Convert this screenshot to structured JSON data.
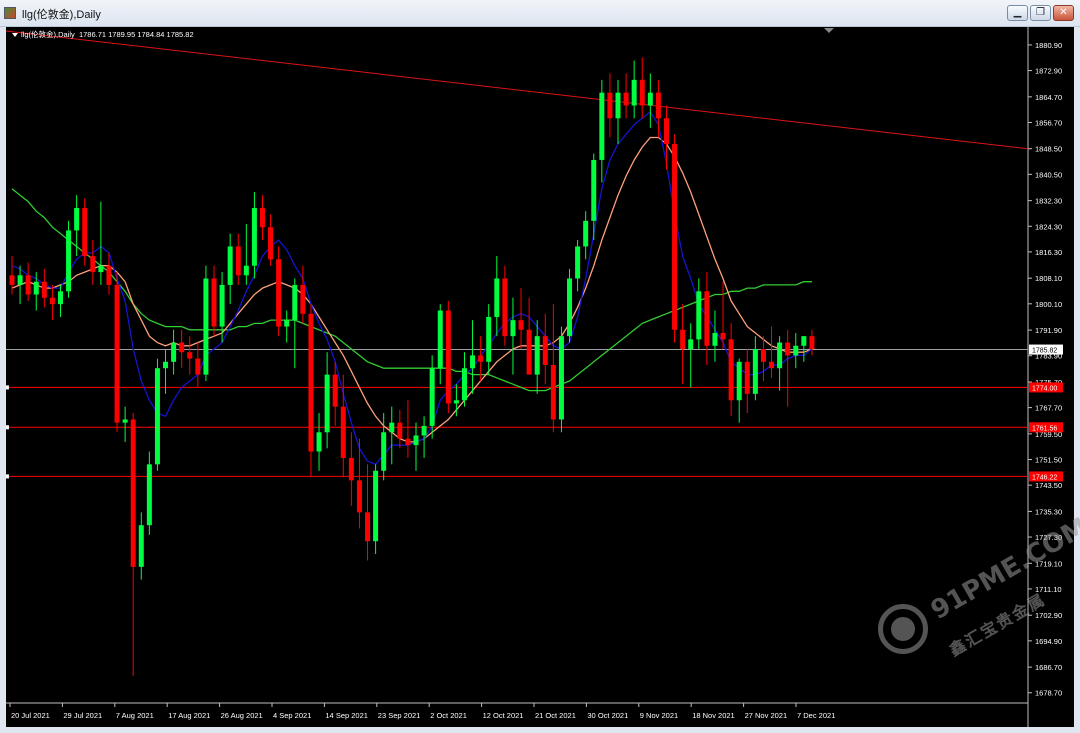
{
  "window": {
    "title": "llg(伦敦金),Daily",
    "buttons": [
      "minimize",
      "restore",
      "close"
    ]
  },
  "chart_header": {
    "symbol": "llg(伦敦金),Daily",
    "ohlc": "1786.71 1789.95 1784.84 1785.82"
  },
  "watermark": {
    "line1": "91PME.COM",
    "line2": "鑫汇宝贵金属"
  },
  "colors": {
    "background": "#000000",
    "bull": "#00ff40",
    "bear": "#ff0000",
    "ma_fast": "#1414d2",
    "ma_mid": "#ffa07a",
    "ma_slow": "#32cd32",
    "trendline": "#dc1414",
    "hline": "#ff0000",
    "last_price_line": "#9aa0a6"
  },
  "chart_data": {
    "type": "candlestick",
    "symbol": "llg(伦敦金)",
    "timeframe": "Daily",
    "ylim": [
      1675.5,
      1886.5
    ],
    "y_ticks": [
      "1880.90",
      "1872.90",
      "1864.70",
      "1856.70",
      "1848.50",
      "1840.50",
      "1832.30",
      "1824.30",
      "1816.30",
      "1808.10",
      "1800.10",
      "1791.90",
      "1783.90",
      "1775.70",
      "1767.70",
      "1759.50",
      "1751.50",
      "1743.50",
      "1735.30",
      "1727.30",
      "1719.10",
      "1711.10",
      "1702.90",
      "1694.90",
      "1686.70",
      "1678.70"
    ],
    "x_labels": [
      "20 Jul 2021",
      "29 Jul 2021",
      "7 Aug 2021",
      "17 Aug 2021",
      "26 Aug 2021",
      "4 Sep 2021",
      "14 Sep 2021",
      "23 Sep 2021",
      "2 Oct 2021",
      "12 Oct 2021",
      "21 Oct 2021",
      "30 Oct 2021",
      "9 Nov 2021",
      "18 Nov 2021",
      "27 Nov 2021",
      "7 Dec 2021"
    ],
    "last_price": "1785.82",
    "horizontal_lines": [
      {
        "price": 1774.0,
        "label": "1774.00"
      },
      {
        "price": 1761.56,
        "label": "1761.56"
      },
      {
        "price": 1746.22,
        "label": "1746.22"
      }
    ],
    "trendline": {
      "from": [
        "2 Jul 2021",
        1886.0
      ],
      "to": [
        "17 Dec 2021",
        1848.5
      ]
    },
    "candles": [
      {
        "o": 1809,
        "h": 1815,
        "l": 1803,
        "c": 1806
      },
      {
        "o": 1806,
        "h": 1812,
        "l": 1800,
        "c": 1809
      },
      {
        "o": 1809,
        "h": 1813,
        "l": 1801,
        "c": 1803
      },
      {
        "o": 1803,
        "h": 1810,
        "l": 1798,
        "c": 1807
      },
      {
        "o": 1807,
        "h": 1811,
        "l": 1799,
        "c": 1802
      },
      {
        "o": 1802,
        "h": 1806,
        "l": 1795,
        "c": 1800
      },
      {
        "o": 1800,
        "h": 1806,
        "l": 1796,
        "c": 1804
      },
      {
        "o": 1804,
        "h": 1826,
        "l": 1802,
        "c": 1823
      },
      {
        "o": 1823,
        "h": 1834,
        "l": 1815,
        "c": 1830
      },
      {
        "o": 1830,
        "h": 1833,
        "l": 1812,
        "c": 1815
      },
      {
        "o": 1815,
        "h": 1820,
        "l": 1806,
        "c": 1810
      },
      {
        "o": 1810,
        "h": 1832,
        "l": 1806,
        "c": 1812
      },
      {
        "o": 1812,
        "h": 1816,
        "l": 1803,
        "c": 1806
      },
      {
        "o": 1806,
        "h": 1810,
        "l": 1760,
        "c": 1763
      },
      {
        "o": 1763,
        "h": 1768,
        "l": 1757,
        "c": 1764
      },
      {
        "o": 1764,
        "h": 1766,
        "l": 1684,
        "c": 1718
      },
      {
        "o": 1718,
        "h": 1735,
        "l": 1714,
        "c": 1731
      },
      {
        "o": 1731,
        "h": 1754,
        "l": 1728,
        "c": 1750
      },
      {
        "o": 1750,
        "h": 1783,
        "l": 1748,
        "c": 1780
      },
      {
        "o": 1780,
        "h": 1786,
        "l": 1772,
        "c": 1782
      },
      {
        "o": 1782,
        "h": 1792,
        "l": 1778,
        "c": 1788
      },
      {
        "o": 1788,
        "h": 1792,
        "l": 1780,
        "c": 1785
      },
      {
        "o": 1785,
        "h": 1790,
        "l": 1778,
        "c": 1783
      },
      {
        "o": 1783,
        "h": 1788,
        "l": 1774,
        "c": 1778
      },
      {
        "o": 1778,
        "h": 1812,
        "l": 1776,
        "c": 1808
      },
      {
        "o": 1808,
        "h": 1812,
        "l": 1790,
        "c": 1793
      },
      {
        "o": 1793,
        "h": 1810,
        "l": 1788,
        "c": 1806
      },
      {
        "o": 1806,
        "h": 1822,
        "l": 1800,
        "c": 1818
      },
      {
        "o": 1818,
        "h": 1822,
        "l": 1806,
        "c": 1809
      },
      {
        "o": 1809,
        "h": 1825,
        "l": 1806,
        "c": 1812
      },
      {
        "o": 1812,
        "h": 1835,
        "l": 1808,
        "c": 1830
      },
      {
        "o": 1830,
        "h": 1834,
        "l": 1820,
        "c": 1824
      },
      {
        "o": 1824,
        "h": 1828,
        "l": 1812,
        "c": 1814
      },
      {
        "o": 1814,
        "h": 1818,
        "l": 1790,
        "c": 1793
      },
      {
        "o": 1793,
        "h": 1798,
        "l": 1788,
        "c": 1795
      },
      {
        "o": 1795,
        "h": 1808,
        "l": 1780,
        "c": 1806
      },
      {
        "o": 1806,
        "h": 1812,
        "l": 1794,
        "c": 1797
      },
      {
        "o": 1797,
        "h": 1800,
        "l": 1746,
        "c": 1754
      },
      {
        "o": 1754,
        "h": 1766,
        "l": 1748,
        "c": 1760
      },
      {
        "o": 1760,
        "h": 1785,
        "l": 1755,
        "c": 1778
      },
      {
        "o": 1778,
        "h": 1782,
        "l": 1762,
        "c": 1768
      },
      {
        "o": 1768,
        "h": 1778,
        "l": 1746,
        "c": 1752
      },
      {
        "o": 1752,
        "h": 1760,
        "l": 1737,
        "c": 1745
      },
      {
        "o": 1745,
        "h": 1758,
        "l": 1730,
        "c": 1735
      },
      {
        "o": 1735,
        "h": 1750,
        "l": 1720,
        "c": 1726
      },
      {
        "o": 1726,
        "h": 1750,
        "l": 1722,
        "c": 1748
      },
      {
        "o": 1748,
        "h": 1766,
        "l": 1745,
        "c": 1760
      },
      {
        "o": 1760,
        "h": 1768,
        "l": 1750,
        "c": 1763
      },
      {
        "o": 1763,
        "h": 1767,
        "l": 1755,
        "c": 1758
      },
      {
        "o": 1758,
        "h": 1770,
        "l": 1752,
        "c": 1756
      },
      {
        "o": 1756,
        "h": 1763,
        "l": 1748,
        "c": 1759
      },
      {
        "o": 1759,
        "h": 1765,
        "l": 1752,
        "c": 1762
      },
      {
        "o": 1762,
        "h": 1784,
        "l": 1758,
        "c": 1780
      },
      {
        "o": 1780,
        "h": 1800,
        "l": 1775,
        "c": 1798
      },
      {
        "o": 1798,
        "h": 1801,
        "l": 1766,
        "c": 1769
      },
      {
        "o": 1769,
        "h": 1775,
        "l": 1765,
        "c": 1770
      },
      {
        "o": 1770,
        "h": 1785,
        "l": 1768,
        "c": 1780
      },
      {
        "o": 1780,
        "h": 1795,
        "l": 1772,
        "c": 1784
      },
      {
        "o": 1784,
        "h": 1790,
        "l": 1776,
        "c": 1782
      },
      {
        "o": 1782,
        "h": 1800,
        "l": 1778,
        "c": 1796
      },
      {
        "o": 1796,
        "h": 1815,
        "l": 1790,
        "c": 1808
      },
      {
        "o": 1808,
        "h": 1812,
        "l": 1787,
        "c": 1790
      },
      {
        "o": 1790,
        "h": 1802,
        "l": 1778,
        "c": 1795
      },
      {
        "o": 1795,
        "h": 1805,
        "l": 1786,
        "c": 1792
      },
      {
        "o": 1792,
        "h": 1802,
        "l": 1782,
        "c": 1778
      },
      {
        "o": 1778,
        "h": 1795,
        "l": 1772,
        "c": 1790
      },
      {
        "o": 1790,
        "h": 1797,
        "l": 1775,
        "c": 1781
      },
      {
        "o": 1781,
        "h": 1800,
        "l": 1760,
        "c": 1764
      },
      {
        "o": 1764,
        "h": 1793,
        "l": 1760,
        "c": 1790
      },
      {
        "o": 1790,
        "h": 1811,
        "l": 1788,
        "c": 1808
      },
      {
        "o": 1808,
        "h": 1820,
        "l": 1804,
        "c": 1818
      },
      {
        "o": 1818,
        "h": 1829,
        "l": 1814,
        "c": 1826
      },
      {
        "o": 1826,
        "h": 1847,
        "l": 1820,
        "c": 1845
      },
      {
        "o": 1845,
        "h": 1870,
        "l": 1838,
        "c": 1866
      },
      {
        "o": 1866,
        "h": 1872,
        "l": 1852,
        "c": 1858
      },
      {
        "o": 1858,
        "h": 1870,
        "l": 1850,
        "c": 1866
      },
      {
        "o": 1866,
        "h": 1872,
        "l": 1858,
        "c": 1862
      },
      {
        "o": 1862,
        "h": 1876,
        "l": 1858,
        "c": 1870
      },
      {
        "o": 1870,
        "h": 1877,
        "l": 1858,
        "c": 1862
      },
      {
        "o": 1862,
        "h": 1872,
        "l": 1855,
        "c": 1866
      },
      {
        "o": 1866,
        "h": 1870,
        "l": 1852,
        "c": 1858
      },
      {
        "o": 1858,
        "h": 1862,
        "l": 1842,
        "c": 1850
      },
      {
        "o": 1850,
        "h": 1853,
        "l": 1788,
        "c": 1792
      },
      {
        "o": 1792,
        "h": 1800,
        "l": 1775,
        "c": 1786
      },
      {
        "o": 1786,
        "h": 1794,
        "l": 1774,
        "c": 1789
      },
      {
        "o": 1789,
        "h": 1808,
        "l": 1786,
        "c": 1804
      },
      {
        "o": 1804,
        "h": 1810,
        "l": 1781,
        "c": 1787
      },
      {
        "o": 1787,
        "h": 1798,
        "l": 1782,
        "c": 1791
      },
      {
        "o": 1791,
        "h": 1807,
        "l": 1786,
        "c": 1789
      },
      {
        "o": 1789,
        "h": 1794,
        "l": 1765,
        "c": 1770
      },
      {
        "o": 1770,
        "h": 1783,
        "l": 1763,
        "c": 1782
      },
      {
        "o": 1782,
        "h": 1786,
        "l": 1766,
        "c": 1772
      },
      {
        "o": 1772,
        "h": 1790,
        "l": 1770,
        "c": 1786
      },
      {
        "o": 1786,
        "h": 1790,
        "l": 1776,
        "c": 1782
      },
      {
        "o": 1782,
        "h": 1793,
        "l": 1777,
        "c": 1780
      },
      {
        "o": 1780,
        "h": 1790,
        "l": 1773,
        "c": 1788
      },
      {
        "o": 1788,
        "h": 1792,
        "l": 1768,
        "c": 1784
      },
      {
        "o": 1784,
        "h": 1791,
        "l": 1780,
        "c": 1787
      },
      {
        "o": 1787,
        "h": 1790,
        "l": 1782,
        "c": 1790
      },
      {
        "o": 1790,
        "h": 1792,
        "l": 1784,
        "c": 1786
      }
    ],
    "ma_fast": [
      1812,
      1811,
      1809,
      1808,
      1806,
      1805,
      1805,
      1810,
      1814,
      1816,
      1816,
      1818,
      1816,
      1808,
      1801,
      1786,
      1776,
      1770,
      1766,
      1765,
      1770,
      1774,
      1776,
      1778,
      1784,
      1786,
      1788,
      1793,
      1798,
      1804,
      1809,
      1815,
      1818,
      1820,
      1817,
      1812,
      1808,
      1800,
      1794,
      1789,
      1782,
      1772,
      1763,
      1755,
      1751,
      1750,
      1753,
      1756,
      1756,
      1756,
      1757,
      1758,
      1762,
      1770,
      1773,
      1775,
      1778,
      1780,
      1784,
      1787,
      1791,
      1794,
      1796,
      1797,
      1796,
      1793,
      1790,
      1787,
      1786,
      1788,
      1796,
      1808,
      1822,
      1836,
      1845,
      1850,
      1853,
      1856,
      1858,
      1860,
      1856,
      1844,
      1828,
      1815,
      1808,
      1800,
      1796,
      1792,
      1788,
      1782,
      1780,
      1778,
      1778,
      1779,
      1781,
      1781,
      1783,
      1784,
      1784,
      1786
    ],
    "ma_mid": [
      1805,
      1806,
      1807,
      1806,
      1805,
      1805,
      1806,
      1807,
      1809,
      1810,
      1811,
      1812,
      1812,
      1810,
      1807,
      1800,
      1795,
      1790,
      1788,
      1787,
      1788,
      1787,
      1787,
      1788,
      1789,
      1790,
      1791,
      1794,
      1797,
      1800,
      1803,
      1805,
      1806,
      1807,
      1806,
      1805,
      1803,
      1800,
      1796,
      1792,
      1788,
      1784,
      1779,
      1774,
      1769,
      1765,
      1762,
      1760,
      1758,
      1757,
      1757,
      1758,
      1760,
      1762,
      1764,
      1767,
      1770,
      1773,
      1776,
      1779,
      1782,
      1784,
      1786,
      1787,
      1787,
      1787,
      1787,
      1788,
      1790,
      1794,
      1799,
      1805,
      1812,
      1820,
      1827,
      1834,
      1840,
      1845,
      1849,
      1852,
      1852,
      1850,
      1846,
      1841,
      1835,
      1828,
      1821,
      1814,
      1808,
      1801,
      1797,
      1793,
      1791,
      1789,
      1787,
      1786,
      1785,
      1785,
      1785,
      1786
    ],
    "ma_slow": [
      1836,
      1834,
      1832,
      1829,
      1827,
      1824,
      1822,
      1820,
      1818,
      1816,
      1814,
      1812,
      1810,
      1807,
      1804,
      1800,
      1797,
      1795,
      1794,
      1793,
      1793,
      1793,
      1792,
      1792,
      1792,
      1792,
      1792,
      1792,
      1793,
      1793,
      1794,
      1794,
      1795,
      1795,
      1795,
      1795,
      1794,
      1793,
      1792,
      1791,
      1790,
      1788,
      1786,
      1784,
      1782,
      1781,
      1780,
      1780,
      1780,
      1780,
      1780,
      1780,
      1780,
      1780,
      1780,
      1779,
      1779,
      1778,
      1778,
      1778,
      1777,
      1776,
      1775,
      1774,
      1773,
      1773,
      1773,
      1774,
      1775,
      1776,
      1778,
      1780,
      1782,
      1784,
      1786,
      1788,
      1790,
      1792,
      1794,
      1795,
      1796,
      1797,
      1798,
      1799,
      1800,
      1801,
      1802,
      1803,
      1803,
      1804,
      1804,
      1805,
      1805,
      1806,
      1806,
      1806,
      1806,
      1806,
      1807,
      1807
    ]
  }
}
